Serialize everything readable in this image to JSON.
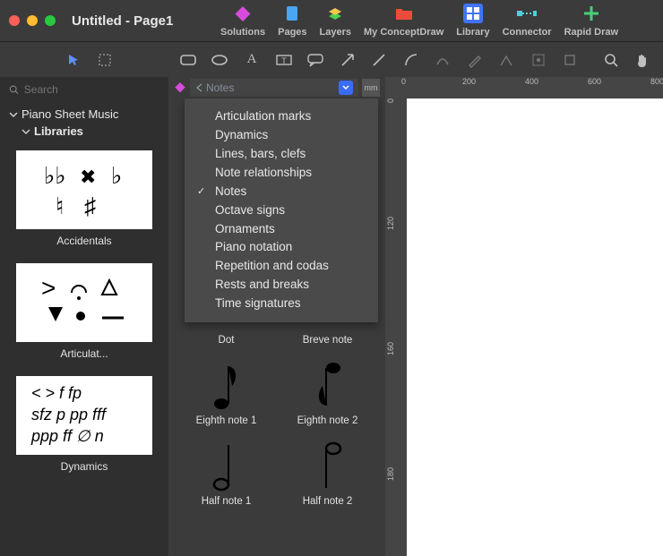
{
  "window": {
    "title": "Untitled - Page1"
  },
  "topmenu": [
    {
      "label": "Solutions",
      "icon": "diamond-pink"
    },
    {
      "label": "Pages",
      "icon": "page-blue"
    },
    {
      "label": "Layers",
      "icon": "stack-green"
    },
    {
      "label": "My ConceptDraw",
      "icon": "folder-red"
    },
    {
      "label": "Library",
      "icon": "grid-blue"
    },
    {
      "label": "Connector",
      "icon": "connector-teal"
    },
    {
      "label": "Rapid Draw",
      "icon": "plus-green"
    }
  ],
  "search": {
    "placeholder": "Search"
  },
  "tree": {
    "root": "Piano Sheet Music",
    "child": "Libraries"
  },
  "libs": [
    {
      "label": "Accidentals"
    },
    {
      "label": "Articulat..."
    },
    {
      "label": "Dynamics"
    }
  ],
  "combo": {
    "value": "Notes",
    "unit": "mm"
  },
  "options": [
    "Articulation marks",
    "Dynamics",
    "Lines, bars, clefs",
    "Note relationships",
    "Notes",
    "Octave signs",
    "Ornaments",
    "Piano notation",
    "Repetition and codas",
    "Rests and breaks",
    "Time signatures"
  ],
  "shapes": [
    {
      "label": "Dot"
    },
    {
      "label": "Breve note"
    },
    {
      "label": "Eighth note 1"
    },
    {
      "label": "Eighth note 2"
    },
    {
      "label": "Half note 1"
    },
    {
      "label": "Half note 2"
    }
  ],
  "ruler_h": [
    "0",
    "200",
    "400",
    "600",
    "800"
  ],
  "ruler_v": [
    "0",
    "120",
    "160",
    "180"
  ]
}
